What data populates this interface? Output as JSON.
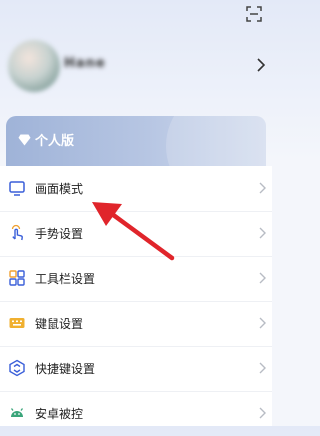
{
  "profile": {
    "username": "Hane"
  },
  "banner": {
    "label": "个人版"
  },
  "menu": {
    "items": [
      {
        "label": "画面模式",
        "icon": "monitor-icon"
      },
      {
        "label": "手势设置",
        "icon": "gesture-hand-icon"
      },
      {
        "label": "工具栏设置",
        "icon": "grid-tools-icon"
      },
      {
        "label": "键鼠设置",
        "icon": "keyboard-icon"
      },
      {
        "label": "快捷键设置",
        "icon": "shortcut-icon"
      },
      {
        "label": "安卓被控",
        "icon": "android-icon"
      }
    ]
  },
  "colors": {
    "accent": "#3a5fd9",
    "banner": "#b7c6e3",
    "annotation_arrow": "#e0252b"
  }
}
